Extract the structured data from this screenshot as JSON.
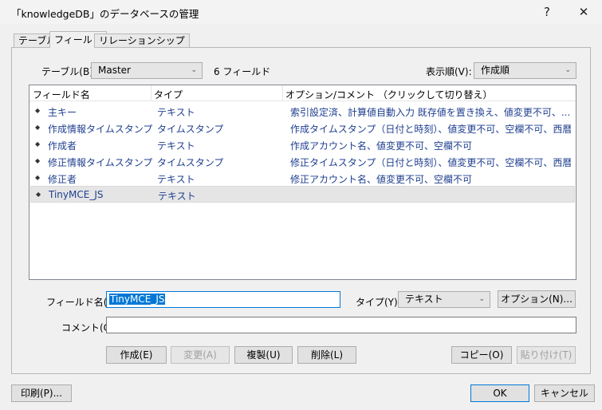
{
  "window": {
    "title": "「knowledgeDB」のデータベースの管理",
    "help_label": "?",
    "close_label": "✕"
  },
  "tabs": [
    "テーブル",
    "フィールド",
    "リレーションシップ"
  ],
  "table_select": {
    "label": "テーブル(B):",
    "value": "Master",
    "count": "6 フィールド"
  },
  "order_select": {
    "label": "表示順(V):",
    "value": "作成順"
  },
  "columns": [
    "フィールド名",
    "タイプ",
    "オプション/コメント （クリックして切り替え）"
  ],
  "fields": [
    {
      "name": "主キー",
      "type": "テキスト",
      "options": "索引設定済、計算値自動入力 既存値を置き換え、値変更不可、..."
    },
    {
      "name": "作成情報タイムスタンプ",
      "type": "タイムスタンプ",
      "options": "作成タイムスタンプ（日付と時刻）、値変更不可、空欄不可、西暦..."
    },
    {
      "name": "作成者",
      "type": "テキスト",
      "options": "作成アカウント名、値変更不可、空欄不可"
    },
    {
      "name": "修正情報タイムスタンプ",
      "type": "タイムスタンプ",
      "options": "修正タイムスタンプ（日付と時刻）、値変更不可、空欄不可、西暦..."
    },
    {
      "name": "修正者",
      "type": "テキスト",
      "options": "修正アカウント名、値変更不可、空欄不可"
    },
    {
      "name": "TinyMCE_JS",
      "type": "テキスト",
      "options": ""
    }
  ],
  "form": {
    "field_name_label": "フィールド名(F):",
    "field_name_value": "TinyMCE_JS",
    "type_label": "タイプ(Y):",
    "type_value": "テキスト",
    "options_button": "オプション(N)...",
    "comment_label": "コメント(C):",
    "comment_value": ""
  },
  "actions": {
    "create": "作成(E)",
    "change": "変更(A)",
    "duplicate": "複製(U)",
    "delete": "削除(L)",
    "copy": "コピー(O)",
    "paste": "貼り付け(T)"
  },
  "footer": {
    "print": "印刷(P)...",
    "ok": "OK",
    "cancel": "キャンセル"
  }
}
